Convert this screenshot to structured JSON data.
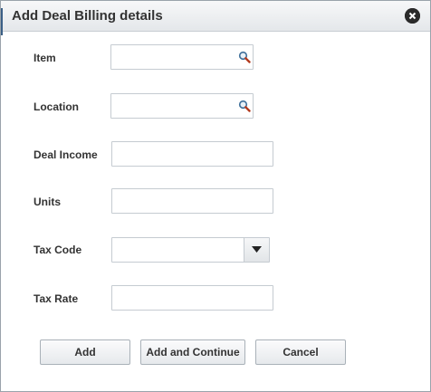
{
  "dialog": {
    "title": "Add Deal Billing details",
    "close_icon": "close-circle-icon"
  },
  "fields": {
    "item": {
      "label": "Item",
      "value": "",
      "icon": "search-icon"
    },
    "location": {
      "label": "Location",
      "value": "",
      "icon": "search-icon"
    },
    "deal_income": {
      "label": "Deal Income",
      "value": ""
    },
    "units": {
      "label": "Units",
      "value": ""
    },
    "tax_code": {
      "label": "Tax Code",
      "selected": "",
      "icon": "chevron-down-icon"
    },
    "tax_rate": {
      "label": "Tax Rate",
      "value": ""
    }
  },
  "buttons": {
    "add": "Add",
    "add_continue": "Add and Continue",
    "cancel": "Cancel"
  },
  "colors": {
    "title_text": "#333333",
    "border": "#c5cbd1",
    "close_bg": "#2a2a2a"
  }
}
